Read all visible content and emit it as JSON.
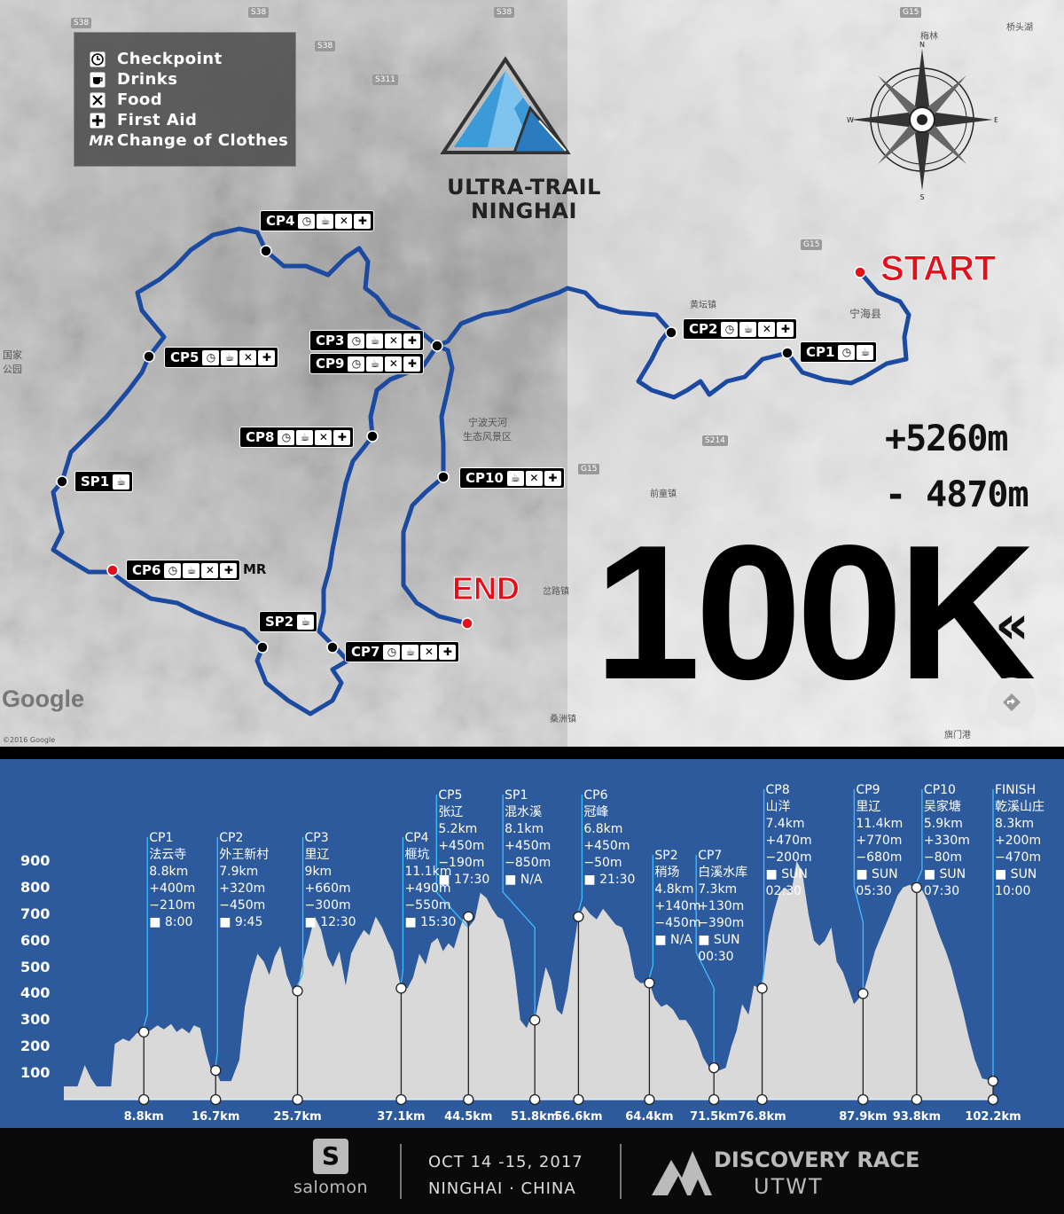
{
  "legend": {
    "items": [
      {
        "icon": "clock-icon",
        "label": "Checkpoint"
      },
      {
        "icon": "cup-icon",
        "label": "Drinks"
      },
      {
        "icon": "food-icon",
        "label": "Food"
      },
      {
        "icon": "first-aid-icon",
        "label": "First Aid"
      },
      {
        "icon": "MR",
        "label": "Change of Clothes"
      }
    ]
  },
  "logo": {
    "line1": "ULTRA-TRAIL",
    "line2": "NINGHAI"
  },
  "map": {
    "start_label": "START",
    "end_label": "END",
    "elevation_gain": "+5260m",
    "elevation_loss": "- 4870m",
    "distance_title": "100K",
    "google_label": "Google",
    "copyright": "©2016 Google",
    "checkpoints": [
      {
        "id": "cp4",
        "label": "CP4",
        "icons": [
          "clock",
          "cup",
          "food",
          "aid"
        ]
      },
      {
        "id": "cp5",
        "label": "CP5",
        "icons": [
          "clock",
          "cup",
          "food",
          "aid"
        ]
      },
      {
        "id": "cp3",
        "label": "CP3",
        "icons": [
          "clock",
          "cup",
          "food",
          "aid"
        ]
      },
      {
        "id": "cp9",
        "label": "CP9",
        "icons": [
          "clock",
          "cup",
          "food",
          "aid"
        ]
      },
      {
        "id": "cp8",
        "label": "CP8",
        "icons": [
          "clock",
          "cup",
          "food",
          "aid"
        ]
      },
      {
        "id": "cp2",
        "label": "CP2",
        "icons": [
          "clock",
          "cup",
          "food",
          "aid"
        ]
      },
      {
        "id": "cp1",
        "label": "CP1",
        "icons": [
          "clock",
          "cup"
        ]
      },
      {
        "id": "sp1",
        "label": "SP1",
        "icons": [
          "cup"
        ]
      },
      {
        "id": "cp10",
        "label": "CP10",
        "icons": [
          "cup",
          "food",
          "aid"
        ]
      },
      {
        "id": "cp6",
        "label": "CP6",
        "icons": [
          "clock",
          "cup",
          "food",
          "aid"
        ],
        "extra": "MR"
      },
      {
        "id": "sp2",
        "label": "SP2",
        "icons": [
          "cup"
        ]
      },
      {
        "id": "cp7",
        "label": "CP7",
        "icons": [
          "clock",
          "cup",
          "food",
          "aid"
        ]
      }
    ],
    "places": [
      {
        "text": "梅林"
      },
      {
        "text": "桥头湖"
      },
      {
        "text": "黄坛镇"
      },
      {
        "text": "宁海县"
      },
      {
        "text": "宁波天河"
      },
      {
        "text": "生态风景区"
      },
      {
        "text": "前童镇"
      },
      {
        "text": "岔路镇"
      },
      {
        "text": "桑洲镇"
      },
      {
        "text": "旗门港"
      },
      {
        "text": "国家"
      },
      {
        "text": "公园"
      }
    ],
    "roads": [
      "S38",
      "S38",
      "S38",
      "S38",
      "S311",
      "G15",
      "G15",
      "G15",
      "S214"
    ],
    "compass_letters": [
      "N",
      "E",
      "S",
      "W"
    ]
  },
  "chart_data": {
    "type": "area",
    "ylim": [
      0,
      950
    ],
    "yticks": [
      100,
      200,
      300,
      400,
      500,
      600,
      700,
      800,
      900
    ],
    "xlim": [
      0,
      102.2
    ],
    "area_color": "#d9d9d9",
    "background_color": "#2d5a9c",
    "profile": [
      [
        0,
        50
      ],
      [
        1.5,
        50
      ],
      [
        2.3,
        130
      ],
      [
        3,
        80
      ],
      [
        3.6,
        50
      ],
      [
        5.2,
        50
      ],
      [
        5.6,
        210
      ],
      [
        6.5,
        230
      ],
      [
        7.2,
        220
      ],
      [
        8,
        250
      ],
      [
        8.8,
        255
      ],
      [
        9.5,
        260
      ],
      [
        10.3,
        280
      ],
      [
        11,
        265
      ],
      [
        11.8,
        285
      ],
      [
        12.4,
        255
      ],
      [
        13,
        270
      ],
      [
        13.8,
        250
      ],
      [
        14.3,
        280
      ],
      [
        15,
        270
      ],
      [
        15.6,
        180
      ],
      [
        16.2,
        110
      ],
      [
        16.7,
        110
      ],
      [
        17.2,
        70
      ],
      [
        18.4,
        70
      ],
      [
        19.3,
        150
      ],
      [
        19.9,
        350
      ],
      [
        20.6,
        470
      ],
      [
        21.3,
        550
      ],
      [
        22,
        520
      ],
      [
        22.6,
        470
      ],
      [
        23.2,
        540
      ],
      [
        23.8,
        580
      ],
      [
        24.5,
        470
      ],
      [
        25.2,
        410
      ],
      [
        25.7,
        410
      ],
      [
        26.3,
        520
      ],
      [
        27,
        610
      ],
      [
        27.6,
        690
      ],
      [
        28.3,
        640
      ],
      [
        29,
        540
      ],
      [
        29.6,
        500
      ],
      [
        30.3,
        560
      ],
      [
        31,
        430
      ],
      [
        31.6,
        550
      ],
      [
        32.3,
        600
      ],
      [
        33,
        640
      ],
      [
        33.6,
        620
      ],
      [
        34.3,
        690
      ],
      [
        35,
        650
      ],
      [
        35.6,
        600
      ],
      [
        36.2,
        560
      ],
      [
        37.1,
        420
      ],
      [
        37.8,
        420
      ],
      [
        38.4,
        460
      ],
      [
        39.1,
        550
      ],
      [
        39.8,
        510
      ],
      [
        40.4,
        590
      ],
      [
        41.1,
        610
      ],
      [
        41.7,
        560
      ],
      [
        42.3,
        590
      ],
      [
        42.9,
        570
      ],
      [
        43.5,
        640
      ],
      [
        44,
        690
      ],
      [
        44.5,
        650
      ],
      [
        45.2,
        680
      ],
      [
        45.8,
        780
      ],
      [
        46.5,
        760
      ],
      [
        47.1,
        720
      ],
      [
        47.7,
        690
      ],
      [
        48.3,
        680
      ],
      [
        49,
        600
      ],
      [
        49.6,
        480
      ],
      [
        50.2,
        300
      ],
      [
        50.9,
        270
      ],
      [
        51.5,
        320
      ],
      [
        51.8,
        300
      ],
      [
        52.4,
        400
      ],
      [
        53,
        500
      ],
      [
        53.6,
        450
      ],
      [
        54.2,
        340
      ],
      [
        54.8,
        320
      ],
      [
        55.4,
        410
      ],
      [
        56,
        560
      ],
      [
        56.6,
        690
      ],
      [
        57.2,
        730
      ],
      [
        57.9,
        700
      ],
      [
        58.6,
        680
      ],
      [
        59.3,
        720
      ],
      [
        60,
        690
      ],
      [
        60.7,
        660
      ],
      [
        61.4,
        650
      ],
      [
        62.1,
        580
      ],
      [
        62.8,
        460
      ],
      [
        63.4,
        440
      ],
      [
        64.4,
        440
      ],
      [
        65,
        380
      ],
      [
        65.7,
        350
      ],
      [
        66.3,
        360
      ],
      [
        67,
        340
      ],
      [
        67.7,
        300
      ],
      [
        68.4,
        300
      ],
      [
        69,
        270
      ],
      [
        69.7,
        220
      ],
      [
        70.3,
        160
      ],
      [
        71,
        120
      ],
      [
        71.5,
        120
      ],
      [
        72.1,
        110
      ],
      [
        72.8,
        120
      ],
      [
        73.4,
        200
      ],
      [
        74,
        260
      ],
      [
        74.6,
        360
      ],
      [
        75.3,
        320
      ],
      [
        75.9,
        430
      ],
      [
        76.5,
        420
      ],
      [
        76.8,
        420
      ],
      [
        77.5,
        620
      ],
      [
        78.1,
        710
      ],
      [
        78.7,
        780
      ],
      [
        79.3,
        800
      ],
      [
        80,
        780
      ],
      [
        80.6,
        900
      ],
      [
        81.2,
        860
      ],
      [
        81.9,
        700
      ],
      [
        82.5,
        600
      ],
      [
        83.1,
        580
      ],
      [
        83.7,
        600
      ],
      [
        84.4,
        650
      ],
      [
        85,
        520
      ],
      [
        85.7,
        480
      ],
      [
        86.3,
        420
      ],
      [
        86.9,
        360
      ],
      [
        87.9,
        400
      ],
      [
        88.5,
        470
      ],
      [
        89.2,
        560
      ],
      [
        89.8,
        610
      ],
      [
        90.4,
        660
      ],
      [
        91,
        710
      ],
      [
        91.7,
        770
      ],
      [
        92.3,
        800
      ],
      [
        93,
        810
      ],
      [
        93.8,
        800
      ],
      [
        94.4,
        790
      ],
      [
        95,
        750
      ],
      [
        95.7,
        680
      ],
      [
        96.3,
        620
      ],
      [
        97,
        560
      ],
      [
        97.6,
        500
      ],
      [
        98.2,
        420
      ],
      [
        98.9,
        330
      ],
      [
        99.5,
        240
      ],
      [
        100.2,
        150
      ],
      [
        101,
        80
      ],
      [
        102.2,
        70
      ]
    ],
    "markers": [
      {
        "id": "cp1",
        "km": 8.8,
        "elev": 255
      },
      {
        "id": "cp2",
        "km": 16.7,
        "elev": 110
      },
      {
        "id": "cp3",
        "km": 25.7,
        "elev": 410
      },
      {
        "id": "cp4",
        "km": 37.1,
        "elev": 420
      },
      {
        "id": "cp5",
        "km": 44.5,
        "elev": 690
      },
      {
        "id": "sp1",
        "km": 51.8,
        "elev": 300
      },
      {
        "id": "cp6",
        "km": 56.6,
        "elev": 690
      },
      {
        "id": "sp2",
        "km": 64.4,
        "elev": 440
      },
      {
        "id": "cp7",
        "km": 71.5,
        "elev": 120
      },
      {
        "id": "cp8",
        "km": 76.8,
        "elev": 420
      },
      {
        "id": "cp9",
        "km": 87.9,
        "elev": 400
      },
      {
        "id": "cp10",
        "km": 93.8,
        "elev": 800
      },
      {
        "id": "finish",
        "km": 102.2,
        "elev": 70
      }
    ],
    "xtick_labels": [
      "8.8km",
      "16.7km",
      "25.7km",
      "37.1km",
      "44.5km",
      "51.8km",
      "56.6km",
      "64.4km",
      "71.5km",
      "76.8km",
      "87.9km",
      "93.8km",
      "102.2km"
    ],
    "annotations": [
      {
        "id": "cp1",
        "text": "CP1\n法云寺\n8.8km\n+400m\n−210m\n■ 8:00"
      },
      {
        "id": "cp2",
        "text": "CP2\n外王新村\n7.9km\n+320m\n−450m\n■ 9:45"
      },
      {
        "id": "cp3",
        "text": "CP3\n里辽\n9km\n+660m\n−300m\n■ 12:30"
      },
      {
        "id": "cp4",
        "text": "CP4\n榧坑\n11.1km\n+490m\n−550m\n■ 15:30"
      },
      {
        "id": "cp5",
        "text": "CP5\n张辽\n5.2km\n+450m\n−190m\n■ 17:30"
      },
      {
        "id": "sp1",
        "text": "SP1\n混水溪\n8.1km\n+450m\n−850m\n■ N/A"
      },
      {
        "id": "cp6",
        "text": "CP6\n冠峰\n6.8km\n+450m\n−50m\n■ 21:30"
      },
      {
        "id": "sp2",
        "text": "SP2\n稍场\n4.8km\n+140m\n−450m\n■ N/A"
      },
      {
        "id": "cp7",
        "text": "CP7\n白溪水库\n7.3km\n+130m\n−390m\n■ SUN\n00:30"
      },
      {
        "id": "cp8",
        "text": "CP8\n山洋\n7.4km\n+470m\n−200m\n■ SUN\n02:30"
      },
      {
        "id": "cp9",
        "text": "CP9\n里辽\n11.4km\n+770m\n−680m\n■ SUN\n05:30"
      },
      {
        "id": "cp10",
        "text": "CP10\n吴家塘\n5.9km\n+330m\n−80m\n■ SUN\n07:30"
      },
      {
        "id": "finish",
        "text": "FINISH\n乾溪山庄\n8.3km\n+200m\n−470m\n■ SUN\n10:00"
      }
    ]
  },
  "footer": {
    "sponsor": "salomon",
    "date_line1": "OCT 14 -15, 2017",
    "date_line2": "NINGHAI · CHINA",
    "organizer_name": "DISCOVERY RACE",
    "organizer_sub": "UTWT"
  }
}
